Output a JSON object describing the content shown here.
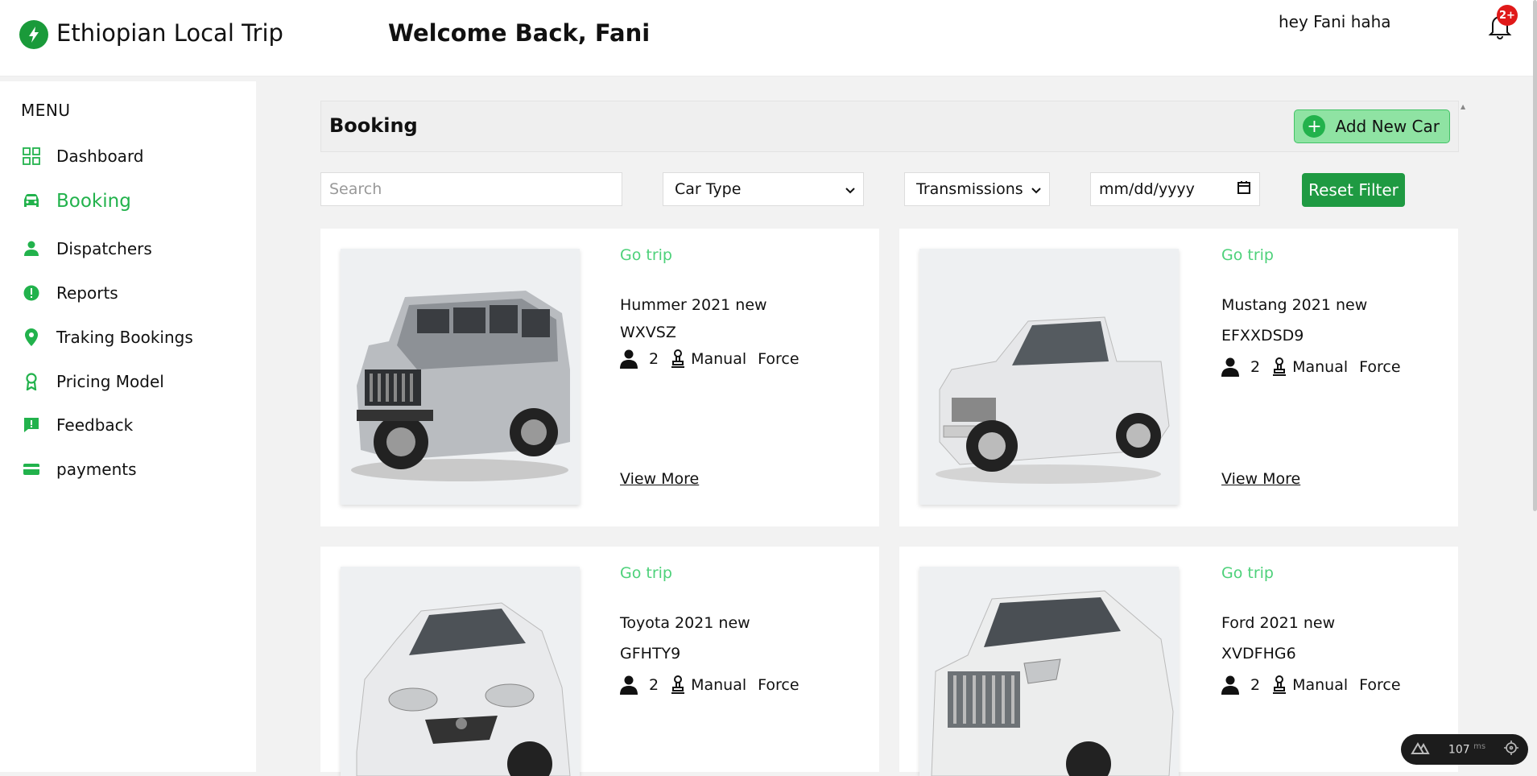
{
  "app": {
    "title": "Ethiopian Local Trip",
    "welcome": "Welcome Back, Fani"
  },
  "header": {
    "greeting": "hey Fani haha",
    "notification_badge": "2+"
  },
  "sidebar": {
    "menu_label": "MENU",
    "items": [
      {
        "label": "Dashboard",
        "icon": "grid-icon",
        "active": false
      },
      {
        "label": "Booking",
        "icon": "car-icon",
        "active": true
      },
      {
        "label": "Dispatchers",
        "icon": "user-icon",
        "active": false
      },
      {
        "label": "Reports",
        "icon": "alert-icon",
        "active": false
      },
      {
        "label": "Traking Bookings",
        "icon": "location-pin-icon",
        "active": false
      },
      {
        "label": "Pricing Model",
        "icon": "award-icon",
        "active": false
      },
      {
        "label": "Feedback",
        "icon": "feedback-icon",
        "active": false
      },
      {
        "label": "payments",
        "icon": "card-icon",
        "active": false
      }
    ]
  },
  "main": {
    "title": "Booking",
    "add_button": "Add New Car",
    "filters": {
      "search_placeholder": "Search",
      "car_type": "Car Type",
      "transmissions": "Transmissions",
      "date_placeholder": "mm/dd/yyyy",
      "reset": "Reset Filter"
    },
    "cars": [
      {
        "tag": "Go trip",
        "name": "Hummer 2021 new",
        "plate": "WXVSZ",
        "seats": "2",
        "transmission": "Manual",
        "fuel": "Force",
        "view_more": "View More"
      },
      {
        "tag": "Go trip",
        "name": "Mustang 2021 new",
        "plate": "EFXXDSD9",
        "seats": "2",
        "transmission": "Manual",
        "fuel": "Force",
        "view_more": "View More"
      },
      {
        "tag": "Go trip",
        "name": "Toyota 2021 new",
        "plate": "GFHTY9",
        "seats": "2",
        "transmission": "Manual",
        "fuel": "Force",
        "view_more": ""
      },
      {
        "tag": "Go trip",
        "name": "Ford 2021 new",
        "plate": "XVDFHG6",
        "seats": "2",
        "transmission": "Manual",
        "fuel": "Force",
        "view_more": ""
      }
    ]
  },
  "perf_widget": {
    "value": "107",
    "unit": "ms"
  },
  "colors": {
    "accent": "#22b24c",
    "go_trip": "#4dd17a",
    "reset": "#1f9a42",
    "badge": "#e01919"
  }
}
